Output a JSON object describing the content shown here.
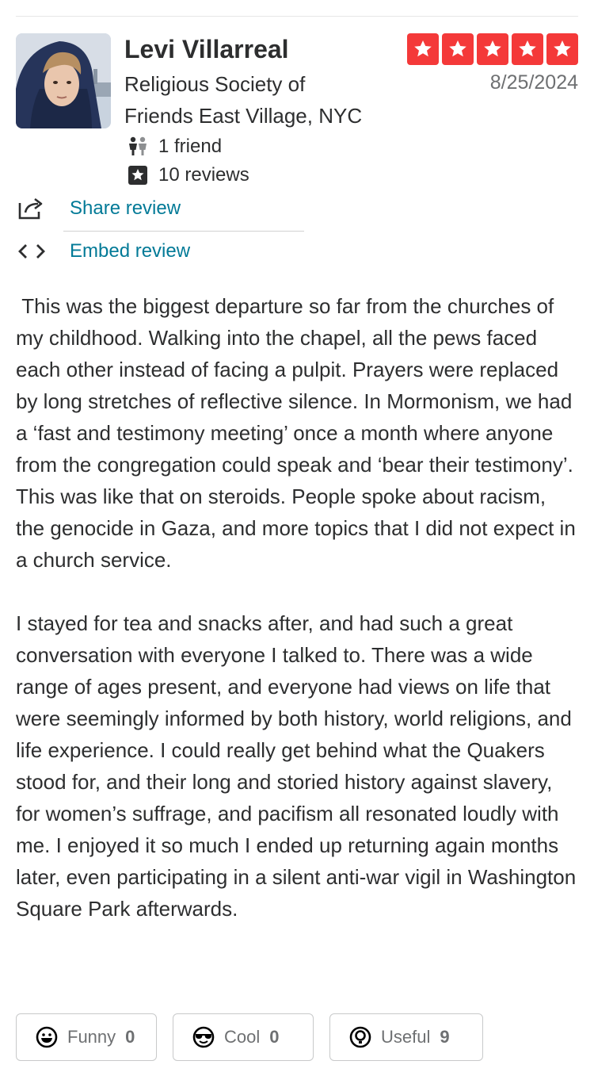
{
  "reviewer": {
    "name": "Levi Villarreal",
    "location_line1": "Religious Society of",
    "location_line2": "Friends East Village, NYC",
    "friends": "1 friend",
    "reviews": "10 reviews"
  },
  "rating": {
    "stars": 5,
    "max": 5,
    "color": "#f43939"
  },
  "date": "8/25/2024",
  "actions": {
    "share": "Share review",
    "embed": "Embed review"
  },
  "review_text": " This was the biggest departure so far from the churches of my childhood. Walking into the chapel, all the pews faced each other instead of facing a pulpit. Prayers were replaced by long stretches of reflective silence. In Mormonism, we had a ‘fast and testimony meeting’ once a month where anyone from the congregation could speak and ‘bear their testimony’. This was like that on steroids. People spoke about racism, the genocide in Gaza, and more topics that I did not expect in a church service.\n\nI stayed for tea and snacks after, and had such a great conversation with everyone I talked to. There was a wide range of ages present, and everyone had views on life that were seemingly informed by both history, world religions, and life experience. I could really get behind what the Quakers stood for, and their long and storied history against slavery, for women’s suffrage, and pacifism all resonated loudly with me. I enjoyed it so much I ended up returning again months later, even participating in a silent anti-war vigil in Washington Square Park afterwards.",
  "reactions": {
    "funny": {
      "label": "Funny",
      "count": "0"
    },
    "cool": {
      "label": "Cool",
      "count": "0"
    },
    "useful": {
      "label": "Useful",
      "count": "9"
    }
  },
  "icons": {
    "friends": "friends-icon",
    "reviews": "star-square-icon",
    "share": "share-icon",
    "embed": "code-icon",
    "funny": "funny-face-icon",
    "cool": "sunglasses-face-icon",
    "useful": "lightbulb-icon"
  }
}
